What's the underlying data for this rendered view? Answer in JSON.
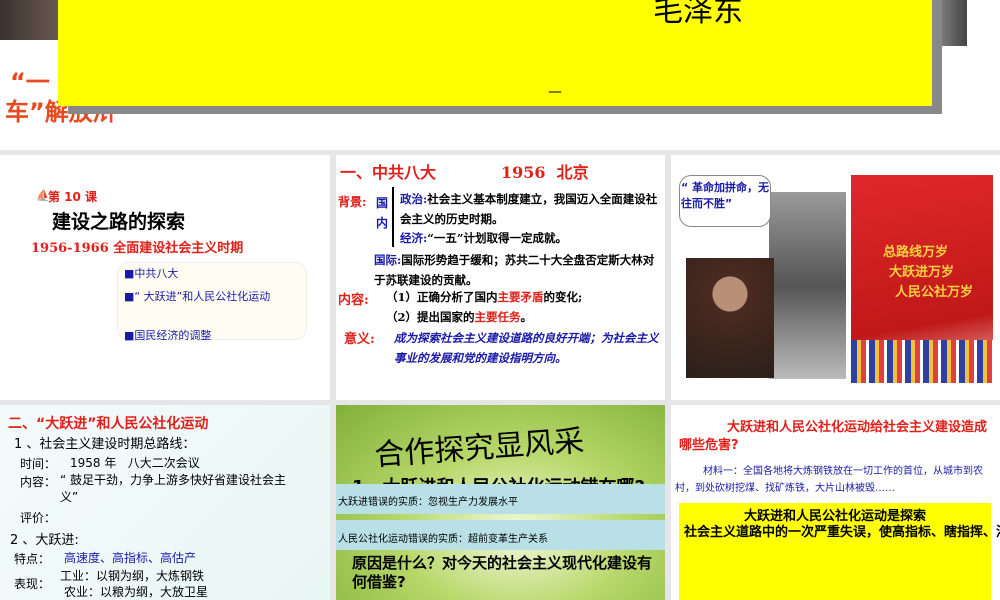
{
  "slide_top": {
    "author": "毛泽东",
    "red_line1": "“一",
    "red_line2": "车”解放浒",
    "dash": "—"
  },
  "slide_title": {
    "lesson": "第 10 课",
    "title": "建设之路的探索",
    "subtitle": "1956-1966 全面建设社会主义时期",
    "items": [
      "■中共八大",
      "■“ 大跃进”和人民公社化运动",
      "■国民经济的调整"
    ]
  },
  "slide_congress": {
    "heading": "一、中共八大",
    "year_place": "1956  北京",
    "bg_label": "背景:",
    "domestic": "国内",
    "politics_label": "政治:",
    "politics": "社会主义基本制度建立，我国迈入全面建设社会主义的历史时期。",
    "economy_label": "经济:",
    "economy": "“一五”计划取得一定成就。",
    "intl_label": "国际:",
    "intl": "国际形势趋于缓和；苏共二十大全盘否定斯大林对于苏联建设的贡献。",
    "content_label": "内容:",
    "content1a": "（1）正确分析了国内",
    "content1b": "主要矛盾",
    "content1c": "的变化;",
    "content2a": "（2）提出国家的",
    "content2b": "主要任务",
    "content2c": "。",
    "meaning_label": "意义:",
    "meaning": "成为探索社会主义建设道路的良好开端；为社会主义事业的发展和党的建设指明方向。"
  },
  "slide_images": {
    "bubble": "“ 革命加拼命，无往而不胜”",
    "banner": [
      "总路线万岁",
      "大跃进万岁",
      "人民公社万岁"
    ]
  },
  "slide_leap": {
    "heading": "二、“大跃进”和人民公社化运动",
    "line1": "1 、社会主义建设时期总路线：",
    "time_label": "时间：",
    "time": "1958 年   八大二次会议",
    "content_label": "内容：",
    "content": "“ 鼓足干劲，力争上游多快好省建设社会主义”",
    "eval": "评价：",
    "line2": "2 、大跃进:",
    "feature_label": "特点：",
    "feature": "高速度、高指标、高估产",
    "perf_label": "表现：",
    "perf1": "工业：以钢为纲，大炼钢铁",
    "perf2": "农业：以粮为纲，大放卫星"
  },
  "slide_discuss": {
    "title": "合作探究显风采",
    "hidden": "1、大跃进和人民公社化运动错在哪?",
    "bar1": "大跃进错误的实质：忽视生产力发展水平",
    "bar2": "人民公社化运动错误的实质：超前变革生产关系",
    "question": "原因是什么？对今天的社会主义现代化建设有何借鉴?"
  },
  "slide_harm": {
    "question": "大跃进和人民公社化运动给社会主义建设造成哪些危害?",
    "material": "材料一：全国各地将大炼钢铁放在一切工作的首位，从城市到农村，到处砍树挖煤、找矿炼铁，大片山林被毁……",
    "box_title": "大跃进和人民公社化运动是探索",
    "box_text": "社会主义道路中的一次严重失误，使高指标、瞎指挥、浮夸风和“共产风”左倾错误严重泛滥，工农业生产遭到严重破坏，国民经济比例严重失调，人民生活发生严"
  }
}
